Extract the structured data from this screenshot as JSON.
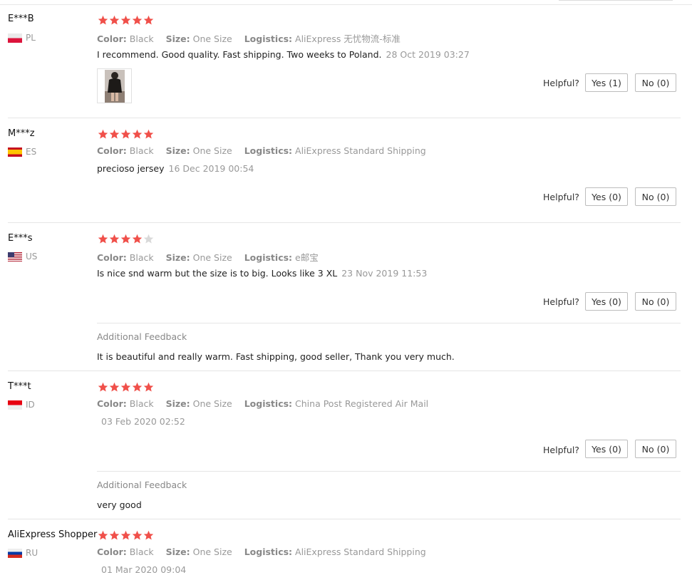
{
  "colors": {
    "star_filled": "#f0504a",
    "star_empty": "#d9d9d9",
    "muted": "#999999"
  },
  "labels": {
    "color": "Color:",
    "size": "Size:",
    "logistics": "Logistics:",
    "helpful": "Helpful?",
    "additional_feedback": "Additional Feedback"
  },
  "reviews": [
    {
      "user": "E***B",
      "country": "PL",
      "flag_icon": "poland-flag-icon",
      "rating": 5,
      "color": "Black",
      "size": "One Size",
      "logistics": "AliExpress 无忧物流-标准",
      "comment": "I recommend. Good quality. Fast shipping. Two weeks to Poland.",
      "date": "28 Oct 2019 03:27",
      "yes": "Yes (1)",
      "no": "No (0)",
      "has_photo": true
    },
    {
      "user": "M***z",
      "country": "ES",
      "flag_icon": "spain-flag-icon",
      "rating": 5,
      "color": "Black",
      "size": "One Size",
      "logistics": "AliExpress Standard Shipping",
      "comment": "precioso jersey",
      "date": "16 Dec 2019 00:54",
      "yes": "Yes (0)",
      "no": "No (0)"
    },
    {
      "user": "E***s",
      "country": "US",
      "flag_icon": "usa-flag-icon",
      "rating": 4,
      "color": "Black",
      "size": "One Size",
      "logistics": "e邮宝",
      "comment": "Is nice snd warm but the size is to big. Looks like 3 XL",
      "date": "23 Nov 2019 11:53",
      "yes": "Yes (0)",
      "no": "No (0)",
      "additional_feedback": "It is beautiful and really warm. Fast shipping, good seller, Thank you very much."
    },
    {
      "user": "T***t",
      "country": "ID",
      "flag_icon": "indonesia-flag-icon",
      "rating": 5,
      "color": "Black",
      "size": "One Size",
      "logistics": "China Post Registered Air Mail",
      "comment": "",
      "date": "03 Feb 2020 02:52",
      "yes": "Yes (0)",
      "no": "No (0)",
      "additional_feedback": "very good"
    },
    {
      "user": "AliExpress Shopper",
      "country": "RU",
      "flag_icon": "russia-flag-icon",
      "rating": 5,
      "color": "Black",
      "size": "One Size",
      "logistics": "AliExpress Standard Shipping",
      "comment": "",
      "date": "01 Mar 2020 09:04"
    }
  ]
}
